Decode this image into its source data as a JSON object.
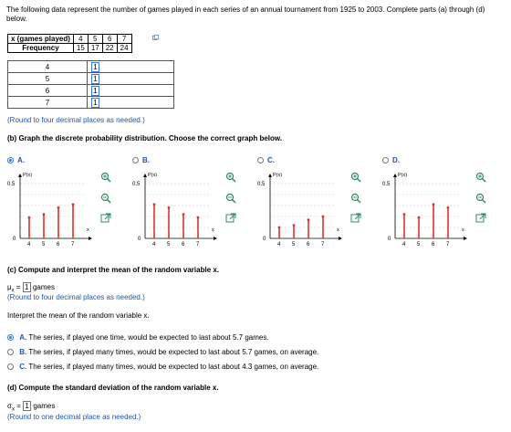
{
  "intro": "The following data represent the number of games played in each series of an annual tournament from 1925 to 2003. Complete parts (a) through (d) below.",
  "freq_table": {
    "header_x": "x (games played)",
    "header_f": "Frequency",
    "x": [
      "4",
      "5",
      "6",
      "7"
    ],
    "f": [
      "15",
      "17",
      "22",
      "24"
    ]
  },
  "prob_table": {
    "rows": [
      {
        "x": "4",
        "p": "1"
      },
      {
        "x": "5",
        "p": "1"
      },
      {
        "x": "6",
        "p": "1"
      },
      {
        "x": "7",
        "p": "1"
      }
    ]
  },
  "round4": "(Round to four decimal places as needed.)",
  "part_b": "(b) Graph the discrete probability distribution. Choose the correct graph below.",
  "graph_options": [
    {
      "label": "A.",
      "selected": true,
      "values": [
        0.19,
        0.22,
        0.28,
        0.31
      ]
    },
    {
      "label": "B.",
      "selected": false,
      "values": [
        0.31,
        0.28,
        0.22,
        0.19
      ]
    },
    {
      "label": "C.",
      "selected": false,
      "values": [
        0.1,
        0.12,
        0.17,
        0.2
      ]
    },
    {
      "label": "D.",
      "selected": false,
      "values": [
        0.22,
        0.19,
        0.31,
        0.28
      ]
    }
  ],
  "chart_data": {
    "type": "bar",
    "ylabel": "P(x)",
    "xlabel": "x",
    "ytick_top": "0.5",
    "ytick_bottom": "0",
    "categories": [
      "4",
      "5",
      "6",
      "7"
    ],
    "ylim": [
      0,
      0.5
    ]
  },
  "part_c": "(c) Compute and interpret the mean of the random variable x.",
  "mu_symbol": "μ",
  "mu_sub": "x",
  "equals": "=",
  "mu_value": "1",
  "games": "games",
  "interpret_mean": "Interpret the mean of the random variable x.",
  "mean_options": [
    {
      "letter": "A.",
      "text": "The series, if played one time, would be expected to last about 5.7 games.",
      "selected": true
    },
    {
      "letter": "B.",
      "text": "The series, if played many times, would be expected to last about 5.7 games, on average.",
      "selected": false
    },
    {
      "letter": "C.",
      "text": "The series, if played many times, would be expected to last about 4.3 games, on average.",
      "selected": false
    }
  ],
  "part_d": "(d) Compute the standard deviation of the random variable x.",
  "sigma_symbol": "σ",
  "sigma_value": "1",
  "round1": "(Round to one decimal place as needed.)",
  "colors": {
    "accent": "#3a7bd5",
    "bar": "#e03030",
    "hint": "#1f57a7"
  }
}
